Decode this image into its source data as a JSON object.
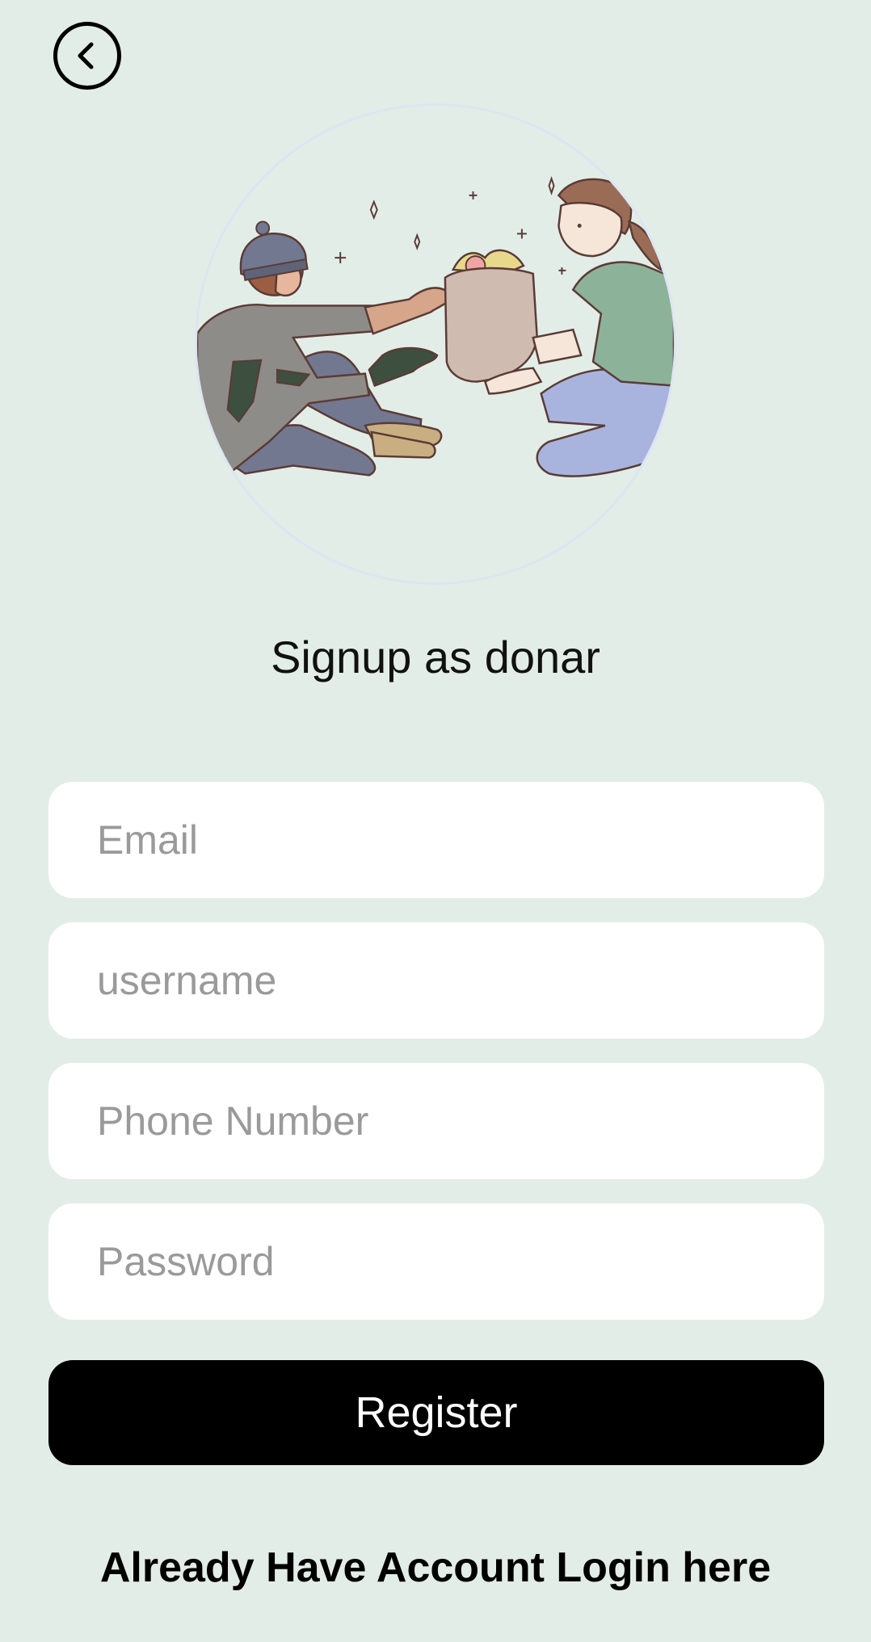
{
  "header": {
    "back_icon": "chevron-left-icon"
  },
  "hero": {
    "illustration": "donation-illustration"
  },
  "form": {
    "title": "Signup as donar",
    "fields": [
      {
        "name": "email",
        "placeholder": "Email",
        "value": ""
      },
      {
        "name": "username",
        "placeholder": "username",
        "value": ""
      },
      {
        "name": "phone",
        "placeholder": "Phone Number",
        "value": ""
      },
      {
        "name": "password",
        "placeholder": "Password",
        "value": ""
      }
    ],
    "register_label": "Register",
    "login_link": "Already Have Account Login here"
  },
  "colors": {
    "background": "#e3ede7",
    "field_bg": "#ffffff",
    "button_bg": "#000000",
    "button_text": "#ffffff",
    "placeholder": "#9a9a9a"
  }
}
